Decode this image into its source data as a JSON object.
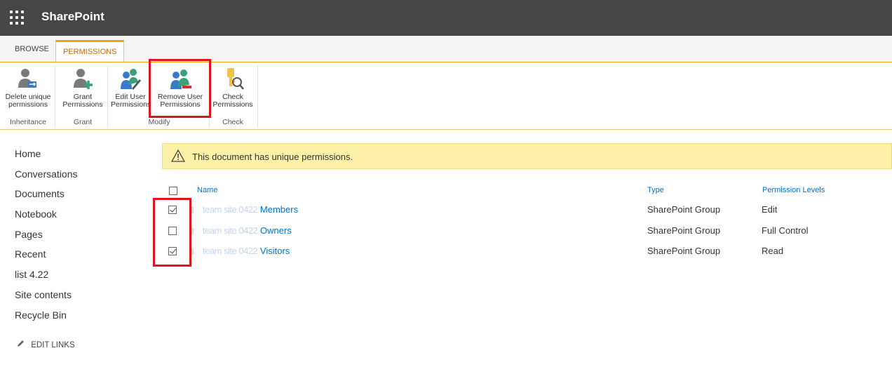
{
  "suite_bar": {
    "brand": "SharePoint"
  },
  "ribbon": {
    "tabs": [
      {
        "label": "BROWSE",
        "active": false
      },
      {
        "label": "PERMISSIONS",
        "active": true
      }
    ],
    "buttons": {
      "delete_unique": {
        "line1": "Delete unique",
        "line2": "permissions"
      },
      "grant": {
        "line1": "Grant",
        "line2": "Permissions"
      },
      "edit_user": {
        "line1": "Edit User",
        "line2": "Permissions"
      },
      "remove_user": {
        "line1": "Remove User",
        "line2": "Permissions"
      },
      "check": {
        "line1": "Check",
        "line2": "Permissions"
      }
    },
    "groups": {
      "inheritance": "Inheritance",
      "grant": "Grant",
      "modify": "Modify",
      "check": "Check"
    }
  },
  "nav": {
    "items": [
      "Home",
      "Conversations",
      "Documents",
      "Notebook",
      "Pages",
      "Recent",
      "list 4.22",
      "Site contents",
      "Recycle Bin"
    ],
    "edit_links": "EDIT LINKS"
  },
  "info_bar": {
    "message": "This document has unique permissions."
  },
  "table": {
    "headers": {
      "name": "Name",
      "type": "Type",
      "levels": "Permission Levels"
    },
    "rows": [
      {
        "name_obscured": "team site 0422",
        "name_suffix": "Members",
        "type": "SharePoint Group",
        "level": "Edit",
        "checked": true
      },
      {
        "name_obscured": "team site 0422",
        "name_suffix": "Owners",
        "type": "SharePoint Group",
        "level": "Full Control",
        "checked": false
      },
      {
        "name_obscured": "team site 0422",
        "name_suffix": "Visitors",
        "type": "SharePoint Group",
        "level": "Read",
        "checked": true
      }
    ]
  },
  "colors": {
    "suite_bar": "#484644",
    "accent": "#f0a30a",
    "link": "#0072c6",
    "highlight": "#e0141e",
    "info_bar": "#fff1a8"
  },
  "icons": [
    "app-launcher-icon",
    "delete-permissions-icon",
    "grant-permissions-icon",
    "edit-permissions-icon",
    "remove-permissions-icon",
    "check-permissions-icon",
    "warning-icon",
    "pencil-icon"
  ]
}
